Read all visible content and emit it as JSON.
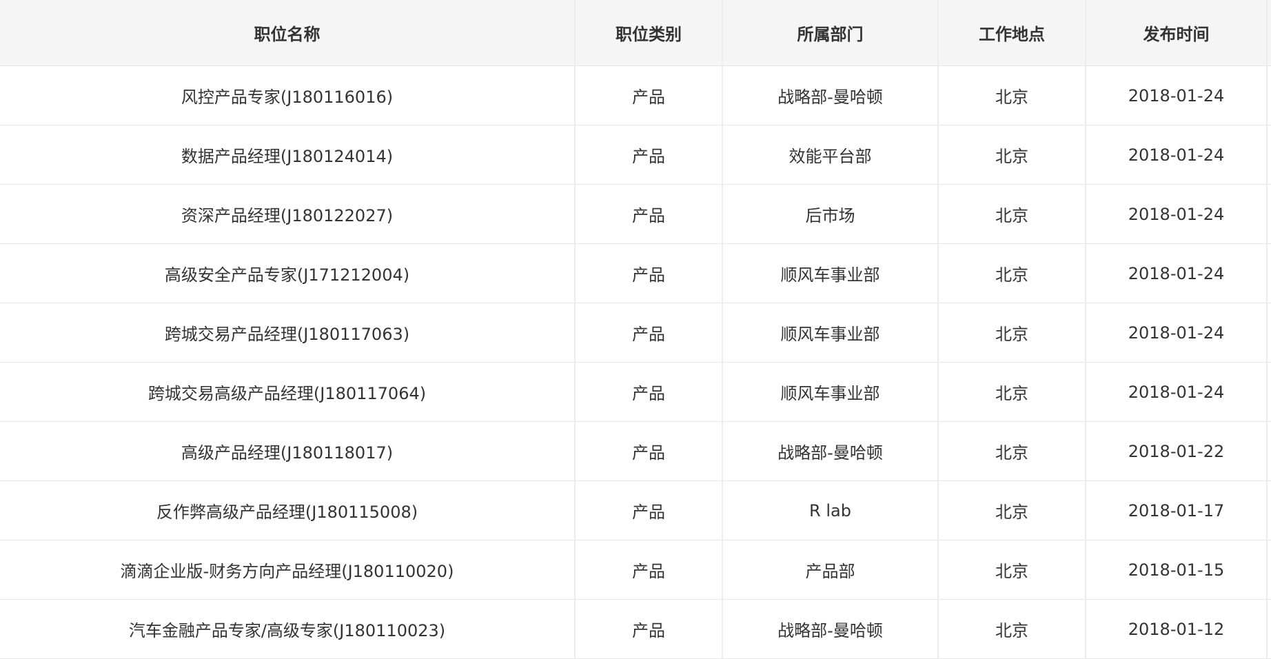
{
  "table": {
    "headers": {
      "title": "职位名称",
      "type": "职位类别",
      "department": "所属部门",
      "location": "工作地点",
      "date": "发布时间"
    },
    "rows": [
      {
        "title": "风控产品专家(J180116016)",
        "type": "产品",
        "department": "战略部-曼哈顿",
        "location": "北京",
        "date": "2018-01-24"
      },
      {
        "title": "数据产品经理(J180124014)",
        "type": "产品",
        "department": "效能平台部",
        "location": "北京",
        "date": "2018-01-24"
      },
      {
        "title": "资深产品经理(J180122027)",
        "type": "产品",
        "department": "后市场",
        "location": "北京",
        "date": "2018-01-24"
      },
      {
        "title": "高级安全产品专家(J171212004)",
        "type": "产品",
        "department": "顺风车事业部",
        "location": "北京",
        "date": "2018-01-24"
      },
      {
        "title": "跨城交易产品经理(J180117063)",
        "type": "产品",
        "department": "顺风车事业部",
        "location": "北京",
        "date": "2018-01-24"
      },
      {
        "title": "跨城交易高级产品经理(J180117064)",
        "type": "产品",
        "department": "顺风车事业部",
        "location": "北京",
        "date": "2018-01-24"
      },
      {
        "title": "高级产品经理(J180118017)",
        "type": "产品",
        "department": "战略部-曼哈顿",
        "location": "北京",
        "date": "2018-01-22"
      },
      {
        "title": "反作弊高级产品经理(J180115008)",
        "type": "产品",
        "department": "R lab",
        "location": "北京",
        "date": "2018-01-17"
      },
      {
        "title": "滴滴企业版-财务方向产品经理(J180110020)",
        "type": "产品",
        "department": "产品部",
        "location": "北京",
        "date": "2018-01-15"
      },
      {
        "title": "汽车金融产品专家/高级专家(J180110023)",
        "type": "产品",
        "department": "战略部-曼哈顿",
        "location": "北京",
        "date": "2018-01-12"
      }
    ]
  }
}
